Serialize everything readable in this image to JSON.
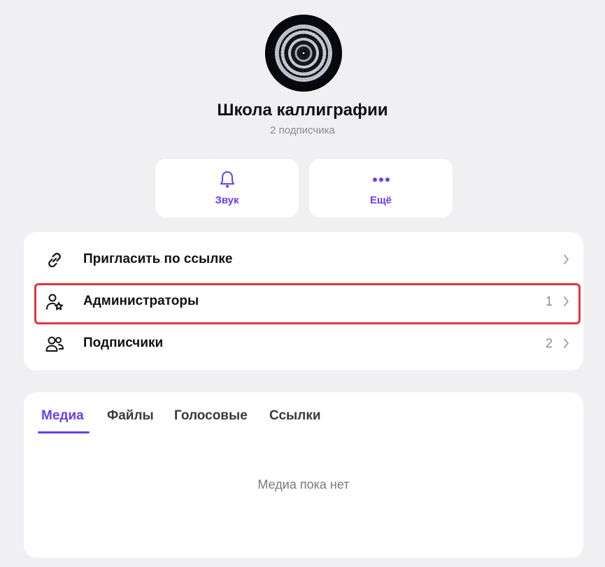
{
  "channel": {
    "name": "Школа каллиграфии",
    "subscribers_text": "2 подписчика"
  },
  "actions": {
    "sound_label": "Звук",
    "more_label": "Ещё"
  },
  "menu": {
    "invite_label": "Пригласить по ссылке",
    "admins_label": "Администраторы",
    "admins_count": "1",
    "subscribers_label": "Подписчики",
    "subscribers_count": "2"
  },
  "tabs": {
    "media": "Медиа",
    "files": "Файлы",
    "voice": "Голосовые",
    "links": "Ссылки"
  },
  "empty_text": "Медиа пока нет",
  "colors": {
    "accent": "#6a3ef0",
    "background": "#f0f0f2",
    "highlight": "#e0353b"
  }
}
